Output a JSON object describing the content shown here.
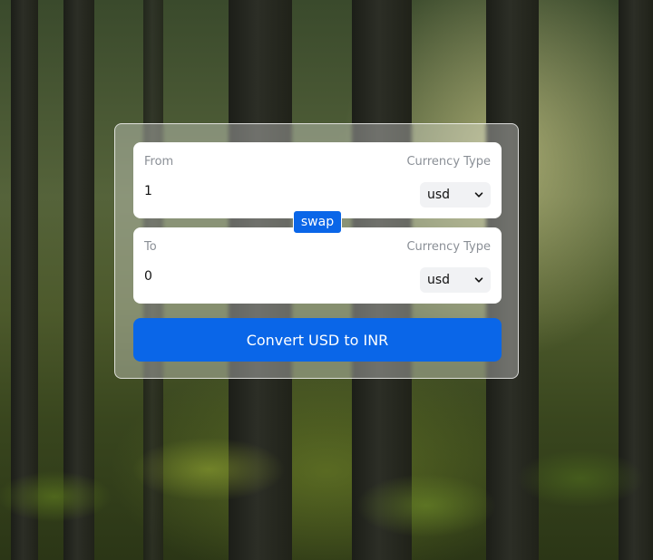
{
  "converter": {
    "from": {
      "label": "From",
      "currency_type_label": "Currency Type",
      "amount": "1",
      "currency": "usd"
    },
    "swap_label": "swap",
    "to": {
      "label": "To",
      "currency_type_label": "Currency Type",
      "amount": "0",
      "currency": "usd"
    },
    "convert_label": "Convert USD to INR"
  },
  "colors": {
    "accent": "#0a66e8",
    "label": "#8a8f96"
  },
  "icons": {
    "select_arrow": "chevron-down-icon"
  }
}
